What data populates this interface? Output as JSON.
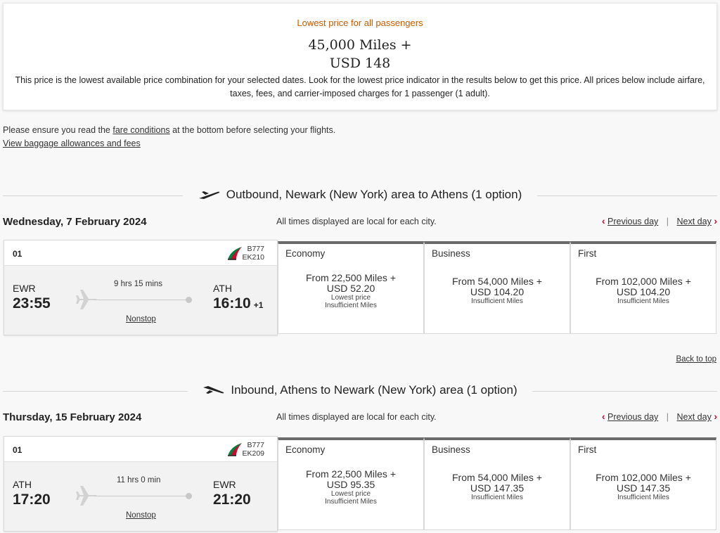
{
  "summary": {
    "label": "Lowest price for all passengers",
    "price_line1": "45,000 Miles +",
    "price_line2": "USD 148",
    "note": "This price is the lowest available price combination for your selected dates. Look for the lowest price indicator in the results below to get this price. All prices below include airfare, taxes, fees, and carrier-imposed charges for 1 passenger (1 adult)."
  },
  "info": {
    "ensure_prefix": "Please ensure you read the ",
    "fare_conditions_link": "fare conditions",
    "ensure_suffix": " at the bottom before selecting your flights.",
    "baggage_link": "View baggage allowances and fees"
  },
  "back_to_top": "Back to top",
  "colors": {
    "accent_orange": "#c65c00",
    "nav_red": "#c60c30",
    "fare_top_border": "#6b6b6b"
  },
  "outbound": {
    "title": "Outbound, Newark (New York) area to Athens (1 option)",
    "date": "Wednesday, 7 February 2024",
    "local_note": "All times displayed are local for each city.",
    "prev_day": "Previous day",
    "next_day": "Next day",
    "sep": "|",
    "flight": {
      "number": "01",
      "aircraft": "B777",
      "flight_code": "EK210",
      "origin_code": "EWR",
      "origin_time": "23:55",
      "dest_code": "ATH",
      "dest_time": "16:10",
      "day_offset": "+1",
      "duration": "9 hrs 15 mins",
      "stops": "Nonstop"
    },
    "fares": [
      {
        "cabin": "Economy",
        "line1": "From 22,500 Miles +",
        "line2": "USD 52.20",
        "lowest": "Lowest price",
        "status": "Insufficient Miles"
      },
      {
        "cabin": "Business",
        "line1": "From 54,000 Miles +",
        "line2": "USD 104.20",
        "status": "Insufficient Miles"
      },
      {
        "cabin": "First",
        "line1": "From 102,000 Miles +",
        "line2": "USD 104.20",
        "status": "Insufficient Miles"
      }
    ]
  },
  "inbound": {
    "title": "Inbound, Athens to Newark (New York) area (1 option)",
    "date": "Thursday, 15 February 2024",
    "local_note": "All times displayed are local for each city.",
    "prev_day": "Previous day",
    "next_day": "Next day",
    "sep": "|",
    "flight": {
      "number": "01",
      "aircraft": "B777",
      "flight_code": "EK209",
      "origin_code": "ATH",
      "origin_time": "17:20",
      "dest_code": "EWR",
      "dest_time": "21:20",
      "duration": "11 hrs 0 min",
      "stops": "Nonstop"
    },
    "fares": [
      {
        "cabin": "Economy",
        "line1": "From 22,500 Miles +",
        "line2": "USD 95.35",
        "lowest": "Lowest price",
        "status": "Insufficient Miles"
      },
      {
        "cabin": "Business",
        "line1": "From 54,000 Miles +",
        "line2": "USD 147.35",
        "status": "Insufficient Miles"
      },
      {
        "cabin": "First",
        "line1": "From 102,000 Miles +",
        "line2": "USD 147.35",
        "status": "Insufficient Miles"
      }
    ]
  }
}
